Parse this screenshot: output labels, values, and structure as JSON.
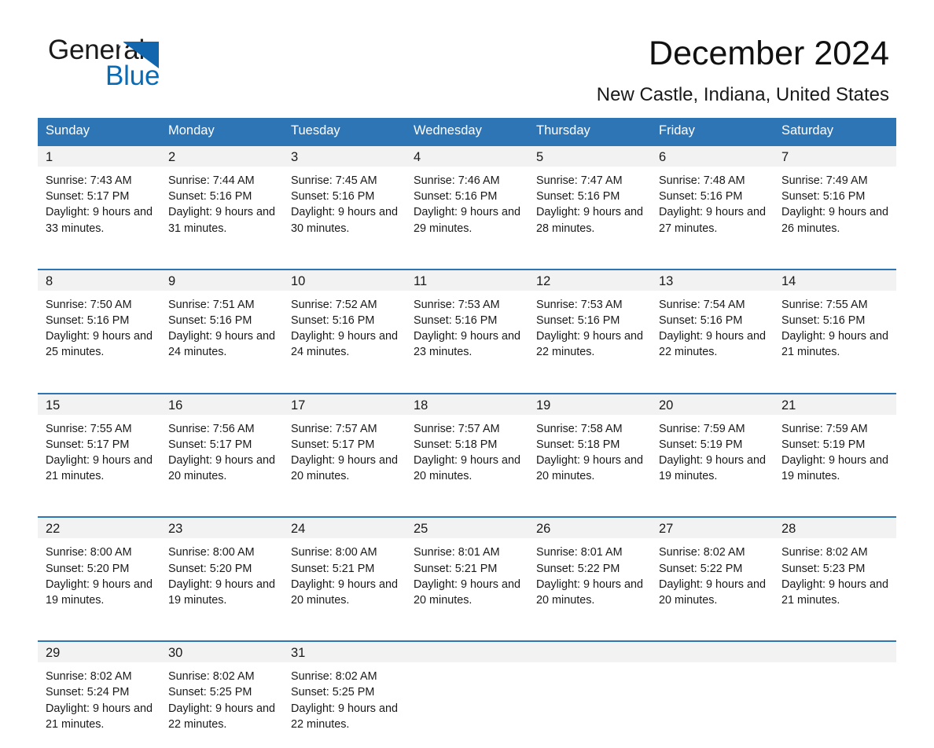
{
  "brand": {
    "name_part1": "General",
    "name_part2": "Blue",
    "triangle_icon": "triangle-icon",
    "accent_color": "#1166ae",
    "blue_text_color": "#0a6bb5"
  },
  "header": {
    "title": "December 2024",
    "subtitle": "New Castle, Indiana, United States"
  },
  "theme": {
    "header_blue": "#2e75b6",
    "day_band_gray": "#f2f2f2",
    "text_color": "#1a1a1a"
  },
  "weekdays": [
    "Sunday",
    "Monday",
    "Tuesday",
    "Wednesday",
    "Thursday",
    "Friday",
    "Saturday"
  ],
  "labels": {
    "sunrise_prefix": "Sunrise: ",
    "sunset_prefix": "Sunset: ",
    "daylight_prefix": "Daylight: "
  },
  "days": [
    {
      "date": "1",
      "sunrise": "Sunrise: 7:43 AM",
      "sunset": "Sunset: 5:17 PM",
      "daylight": "Daylight: 9 hours and 33 minutes."
    },
    {
      "date": "2",
      "sunrise": "Sunrise: 7:44 AM",
      "sunset": "Sunset: 5:16 PM",
      "daylight": "Daylight: 9 hours and 31 minutes."
    },
    {
      "date": "3",
      "sunrise": "Sunrise: 7:45 AM",
      "sunset": "Sunset: 5:16 PM",
      "daylight": "Daylight: 9 hours and 30 minutes."
    },
    {
      "date": "4",
      "sunrise": "Sunrise: 7:46 AM",
      "sunset": "Sunset: 5:16 PM",
      "daylight": "Daylight: 9 hours and 29 minutes."
    },
    {
      "date": "5",
      "sunrise": "Sunrise: 7:47 AM",
      "sunset": "Sunset: 5:16 PM",
      "daylight": "Daylight: 9 hours and 28 minutes."
    },
    {
      "date": "6",
      "sunrise": "Sunrise: 7:48 AM",
      "sunset": "Sunset: 5:16 PM",
      "daylight": "Daylight: 9 hours and 27 minutes."
    },
    {
      "date": "7",
      "sunrise": "Sunrise: 7:49 AM",
      "sunset": "Sunset: 5:16 PM",
      "daylight": "Daylight: 9 hours and 26 minutes."
    },
    {
      "date": "8",
      "sunrise": "Sunrise: 7:50 AM",
      "sunset": "Sunset: 5:16 PM",
      "daylight": "Daylight: 9 hours and 25 minutes."
    },
    {
      "date": "9",
      "sunrise": "Sunrise: 7:51 AM",
      "sunset": "Sunset: 5:16 PM",
      "daylight": "Daylight: 9 hours and 24 minutes."
    },
    {
      "date": "10",
      "sunrise": "Sunrise: 7:52 AM",
      "sunset": "Sunset: 5:16 PM",
      "daylight": "Daylight: 9 hours and 24 minutes."
    },
    {
      "date": "11",
      "sunrise": "Sunrise: 7:53 AM",
      "sunset": "Sunset: 5:16 PM",
      "daylight": "Daylight: 9 hours and 23 minutes."
    },
    {
      "date": "12",
      "sunrise": "Sunrise: 7:53 AM",
      "sunset": "Sunset: 5:16 PM",
      "daylight": "Daylight: 9 hours and 22 minutes."
    },
    {
      "date": "13",
      "sunrise": "Sunrise: 7:54 AM",
      "sunset": "Sunset: 5:16 PM",
      "daylight": "Daylight: 9 hours and 22 minutes."
    },
    {
      "date": "14",
      "sunrise": "Sunrise: 7:55 AM",
      "sunset": "Sunset: 5:16 PM",
      "daylight": "Daylight: 9 hours and 21 minutes."
    },
    {
      "date": "15",
      "sunrise": "Sunrise: 7:55 AM",
      "sunset": "Sunset: 5:17 PM",
      "daylight": "Daylight: 9 hours and 21 minutes."
    },
    {
      "date": "16",
      "sunrise": "Sunrise: 7:56 AM",
      "sunset": "Sunset: 5:17 PM",
      "daylight": "Daylight: 9 hours and 20 minutes."
    },
    {
      "date": "17",
      "sunrise": "Sunrise: 7:57 AM",
      "sunset": "Sunset: 5:17 PM",
      "daylight": "Daylight: 9 hours and 20 minutes."
    },
    {
      "date": "18",
      "sunrise": "Sunrise: 7:57 AM",
      "sunset": "Sunset: 5:18 PM",
      "daylight": "Daylight: 9 hours and 20 minutes."
    },
    {
      "date": "19",
      "sunrise": "Sunrise: 7:58 AM",
      "sunset": "Sunset: 5:18 PM",
      "daylight": "Daylight: 9 hours and 20 minutes."
    },
    {
      "date": "20",
      "sunrise": "Sunrise: 7:59 AM",
      "sunset": "Sunset: 5:19 PM",
      "daylight": "Daylight: 9 hours and 19 minutes."
    },
    {
      "date": "21",
      "sunrise": "Sunrise: 7:59 AM",
      "sunset": "Sunset: 5:19 PM",
      "daylight": "Daylight: 9 hours and 19 minutes."
    },
    {
      "date": "22",
      "sunrise": "Sunrise: 8:00 AM",
      "sunset": "Sunset: 5:20 PM",
      "daylight": "Daylight: 9 hours and 19 minutes."
    },
    {
      "date": "23",
      "sunrise": "Sunrise: 8:00 AM",
      "sunset": "Sunset: 5:20 PM",
      "daylight": "Daylight: 9 hours and 19 minutes."
    },
    {
      "date": "24",
      "sunrise": "Sunrise: 8:00 AM",
      "sunset": "Sunset: 5:21 PM",
      "daylight": "Daylight: 9 hours and 20 minutes."
    },
    {
      "date": "25",
      "sunrise": "Sunrise: 8:01 AM",
      "sunset": "Sunset: 5:21 PM",
      "daylight": "Daylight: 9 hours and 20 minutes."
    },
    {
      "date": "26",
      "sunrise": "Sunrise: 8:01 AM",
      "sunset": "Sunset: 5:22 PM",
      "daylight": "Daylight: 9 hours and 20 minutes."
    },
    {
      "date": "27",
      "sunrise": "Sunrise: 8:02 AM",
      "sunset": "Sunset: 5:22 PM",
      "daylight": "Daylight: 9 hours and 20 minutes."
    },
    {
      "date": "28",
      "sunrise": "Sunrise: 8:02 AM",
      "sunset": "Sunset: 5:23 PM",
      "daylight": "Daylight: 9 hours and 21 minutes."
    },
    {
      "date": "29",
      "sunrise": "Sunrise: 8:02 AM",
      "sunset": "Sunset: 5:24 PM",
      "daylight": "Daylight: 9 hours and 21 minutes."
    },
    {
      "date": "30",
      "sunrise": "Sunrise: 8:02 AM",
      "sunset": "Sunset: 5:25 PM",
      "daylight": "Daylight: 9 hours and 22 minutes."
    },
    {
      "date": "31",
      "sunrise": "Sunrise: 8:02 AM",
      "sunset": "Sunset: 5:25 PM",
      "daylight": "Daylight: 9 hours and 22 minutes."
    }
  ],
  "grid": {
    "first_day_column": 0,
    "weeks": 5
  }
}
